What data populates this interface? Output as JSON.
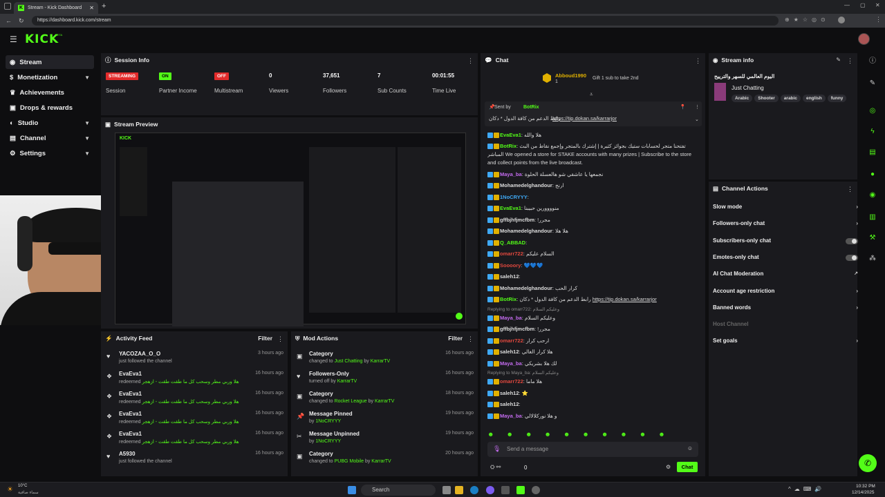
{
  "browser": {
    "tab_title": "Stream - Kick Dashboard",
    "new_tab": "+",
    "url": "https://dashboard.kick.com/stream",
    "window_controls": [
      "—",
      "▢",
      "✕"
    ]
  },
  "topbar": {
    "logo": "KICK",
    "logo_sup": "BETA"
  },
  "sidebar": {
    "items": [
      {
        "label": "Stream",
        "icon": "stream-icon",
        "expandable": false,
        "active": true
      },
      {
        "label": "Monetization",
        "icon": "dollar-icon",
        "expandable": true
      },
      {
        "label": "Achievements",
        "icon": "trophy-icon",
        "expandable": false
      },
      {
        "label": "Drops & rewards",
        "icon": "gift-icon",
        "expandable": false
      },
      {
        "label": "Studio",
        "icon": "studio-icon",
        "expandable": true
      },
      {
        "label": "Channel",
        "icon": "channel-icon",
        "expandable": true
      },
      {
        "label": "Settings",
        "icon": "gear-icon",
        "expandable": true
      }
    ]
  },
  "session": {
    "title": "Session Info",
    "stats": [
      {
        "value": "STREAMING",
        "label": "Session",
        "badge_color": "#e32b2b"
      },
      {
        "value": "ON",
        "label": "Partner Income",
        "badge_color": "#53fc18"
      },
      {
        "value": "OFF",
        "label": "Multistream",
        "badge_color": "#e32b2b"
      },
      {
        "value": "0",
        "label": "Viewers"
      },
      {
        "value": "37,651",
        "label": "Followers"
      },
      {
        "value": "7",
        "label": "Sub Counts"
      },
      {
        "value": "00:01:55",
        "label": "Time Live"
      }
    ]
  },
  "preview": {
    "title": "Stream Preview"
  },
  "activity": {
    "title": "Activity Feed",
    "filter": "Filter",
    "rows": [
      {
        "icon": "heart-icon",
        "name": "YACOZAA_O_O",
        "sub": "just followed the channel",
        "time": "3 hours ago"
      },
      {
        "icon": "reward-icon",
        "name": "EvaEva1",
        "sub_pre": "redeemed ",
        "sub_hl": "هلا وربي مطر وسحب كل ما طقت طقت - ازهجر",
        "time": "16 hours ago"
      },
      {
        "icon": "reward-icon",
        "name": "EvaEva1",
        "sub_pre": "redeemed ",
        "sub_hl": "هلا وربي مطر وسحب كل ما طقت طقت - ازهجر",
        "time": "16 hours ago"
      },
      {
        "icon": "reward-icon",
        "name": "EvaEva1",
        "sub_pre": "redeemed ",
        "sub_hl": "هلا وربي مطر وسحب كل ما طقت طقت - ازهجر",
        "time": "16 hours ago"
      },
      {
        "icon": "reward-icon",
        "name": "EvaEva1",
        "sub_pre": "redeemed ",
        "sub_hl": "هلا وربي مطر وسحب كل ما طقت طقت - ازهجر",
        "time": "16 hours ago"
      },
      {
        "icon": "heart-icon",
        "name": "A5930",
        "sub": "just followed the channel",
        "time": "16 hours ago"
      }
    ]
  },
  "mod": {
    "title": "Mod Actions",
    "filter": "Filter",
    "rows": [
      {
        "icon": "category-icon",
        "name": "Category",
        "pre": "changed to ",
        "hl": "Just Chatting",
        "mid": " by ",
        "by": "KarrarTV",
        "time": "16 hours ago"
      },
      {
        "icon": "heart-icon",
        "name": "Followers-Only",
        "pre": "turned off",
        "hl": "",
        "mid": " by ",
        "by": "KarrarTV",
        "time": "16 hours ago"
      },
      {
        "icon": "category-icon",
        "name": "Category",
        "pre": "changed to ",
        "hl": "Rocket League",
        "mid": " by ",
        "by": "KarrarTV",
        "time": "18 hours ago"
      },
      {
        "icon": "pin-icon",
        "name": "Message Pinned",
        "pre": "",
        "hl": "",
        "mid": "by ",
        "by": "1NoCRYYY",
        "time": "19 hours ago"
      },
      {
        "icon": "unpin-icon",
        "name": "Message Unpinned",
        "pre": "",
        "hl": "",
        "mid": "by ",
        "by": "1NoCRYYY",
        "time": "19 hours ago"
      },
      {
        "icon": "category-icon",
        "name": "Category",
        "pre": "changed to ",
        "hl": "PUBG Mobile",
        "mid": " by ",
        "by": "KarrarTV",
        "time": "20 hours ago"
      }
    ]
  },
  "chat": {
    "title": "Chat",
    "gifter": {
      "name": "Abboud1990",
      "count": "1",
      "gift_text": "Gift 1 sub to take 2nd"
    },
    "pinned": {
      "sent_by": "Sent by",
      "bot": "BotRix",
      "text": "رابط الدعم من كافة الدول * دكان",
      "link": "https://tip.dokan.sa/karrarjor"
    },
    "lines": [
      {
        "user": "EvaEva1",
        "color": "#53fc18",
        "msg": "هلا والله"
      },
      {
        "user": "BotRix",
        "color": "#53fc18",
        "msg": "We opened a store for STAKE accounts with many prizes | Subscribe to the store and collect points from the live broadcast.",
        "rtl_prefix": "تفتحنا متجر لحسابات ستيك بجوائز كثيرة | إشترك بالمتجر وإجمع نقاط من البث المباشر"
      },
      {
        "user": "Maya_ba",
        "color": "#c56cf0",
        "msg": "نجمعها يا عاشقي شو هالعسلة الحلوة"
      },
      {
        "user": "Mohamedelghandour",
        "color": "#ddd",
        "msg": "ارنج"
      },
      {
        "user": "1NoCRYYY",
        "color": "#3fa9f5",
        "msg": ""
      },
      {
        "user": "EvaEva1",
        "color": "#53fc18",
        "msg": "منوووورين حبيبنا"
      },
      {
        "user": "gffbjhfjmcfbm",
        "color": "#ddd",
        "msg": "!مجرر"
      },
      {
        "user": "Mohamedelghandour",
        "color": "#ddd",
        "msg": "هلا هلا"
      },
      {
        "user": "Q_ABBAD",
        "color": "#53fc18",
        "msg": ""
      },
      {
        "user": "omarr722",
        "color": "#e0483e",
        "msg": "السلام عليكم"
      },
      {
        "user": "Soooory",
        "color": "#e0483e",
        "msg": "💙💙💙"
      },
      {
        "user": "saleh12",
        "color": "#ddd",
        "msg": ""
      },
      {
        "user": "Mohamedelghandour",
        "color": "#ddd",
        "msg": "كرار الحب"
      },
      {
        "user": "BotRix",
        "color": "#53fc18",
        "msg": "رابط الدعم من كافة الدول * دكان",
        "link": "https://tip.dokan.sa/karrarjor"
      },
      {
        "reply": "Replying to omarr722: وعليكم السلام"
      },
      {
        "user": "Maya_ba",
        "color": "#c56cf0",
        "msg": "وعليكم السلام"
      },
      {
        "user": "gffbjhfjmcfbm",
        "color": "#ddd",
        "msg": "!مجرر"
      },
      {
        "user": "omarr722",
        "color": "#e0483e",
        "msg": "ارحب كرار"
      },
      {
        "user": "saleh12",
        "color": "#ddd",
        "msg": "هلا كرار الغالي"
      },
      {
        "user": "Maya_ba",
        "color": "#c56cf0",
        "msg": "لك هلا بشريكي"
      },
      {
        "reply": "Replying to Maya_ba: وعليكم السلام"
      },
      {
        "user": "omarr722",
        "color": "#e0483e",
        "msg": "هلا ماما"
      },
      {
        "user": "saleh12",
        "color": "#ddd",
        "msg": "⭐"
      },
      {
        "user": "saleh12",
        "color": "#ddd",
        "msg": ""
      },
      {
        "user": "Maya_ba",
        "color": "#c56cf0",
        "msg": "و هلا نوركلالالي"
      }
    ],
    "input_placeholder": "Send a message",
    "viewer_count": "0",
    "send_label": "Chat"
  },
  "stream_info": {
    "title": "Stream info",
    "stream_title": "اليوم العالمي للسهر والترييح",
    "category": "Just Chatting",
    "tags": [
      "Arabic",
      "Shooter",
      "arabic",
      "english",
      "funny"
    ]
  },
  "channel_actions": {
    "title": "Channel Actions",
    "items": [
      {
        "label": "Slow mode",
        "kind": "chevron"
      },
      {
        "label": "Followers-only chat",
        "kind": "chevron"
      },
      {
        "label": "Subscribers-only chat",
        "kind": "toggle"
      },
      {
        "label": "Emotes-only chat",
        "kind": "toggle"
      },
      {
        "label": "AI Chat Moderation",
        "kind": "external"
      },
      {
        "label": "Account age restriction",
        "kind": "chevron"
      },
      {
        "label": "Banned words",
        "kind": "chevron"
      },
      {
        "label": "Host Channel",
        "kind": "disabled"
      },
      {
        "label": "Set goals",
        "kind": "chevron"
      }
    ]
  },
  "taskbar": {
    "weather_temp": "10°C",
    "weather_text": "سماء صافية",
    "search": "Search",
    "time": "10:32 PM",
    "date": "12/14/2025"
  },
  "colors": {
    "accent": "#53fc18",
    "live_red": "#e32b2b",
    "panel": "#1a1a1e",
    "bg": "#0e0e10"
  }
}
